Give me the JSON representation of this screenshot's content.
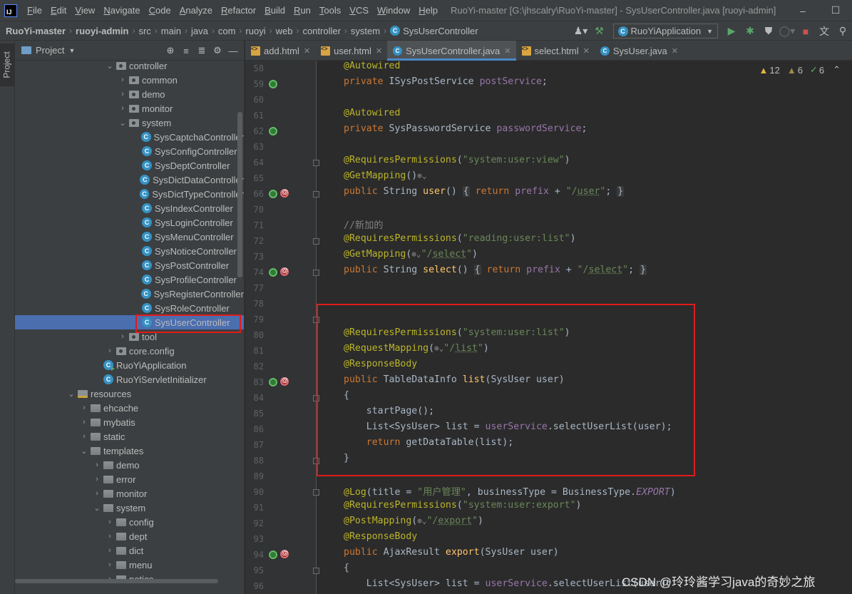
{
  "menubar": {
    "app_logo": "IJ",
    "items": [
      "File",
      "Edit",
      "View",
      "Navigate",
      "Code",
      "Analyze",
      "Refactor",
      "Build",
      "Run",
      "Tools",
      "VCS",
      "Window",
      "Help"
    ],
    "window_title": "RuoYi-master [G:\\jhscalry\\RuoYi-master] - SysUserController.java [ruoyi-admin]",
    "controls": [
      "–",
      "☐"
    ]
  },
  "navbar": {
    "breadcrumbs": [
      "RuoYi-master",
      "ruoyi-admin",
      "src",
      "main",
      "java",
      "com",
      "ruoyi",
      "web",
      "controller",
      "system",
      "SysUserController"
    ],
    "run_config": "RuoYiApplication",
    "toolbar_icons": [
      "user-icon",
      "hammer-icon",
      "run-icon",
      "debug-icon",
      "coverage-icon",
      "profiler-icon",
      "stop-icon",
      "translate-icon",
      "search-everywhere-icon"
    ]
  },
  "left_stripe": {
    "project_label": "Project"
  },
  "project_panel": {
    "title": "Project",
    "header_icons": [
      "locate-icon",
      "expand-all-icon",
      "collapse-all-icon",
      "gear-icon",
      "minimize-icon"
    ],
    "tree": [
      {
        "label": "controller",
        "type": "pkg",
        "arrow": "⌄"
      },
      {
        "label": "common",
        "type": "pkg",
        "arrow": "›"
      },
      {
        "label": "demo",
        "type": "pkg",
        "arrow": "›"
      },
      {
        "label": "monitor",
        "type": "pkg",
        "arrow": "›"
      },
      {
        "label": "system",
        "type": "pkg",
        "arrow": "⌄"
      },
      {
        "label": "SysCaptchaController",
        "type": "cls",
        "arrow": ""
      },
      {
        "label": "SysConfigController",
        "type": "cls",
        "arrow": ""
      },
      {
        "label": "SysDeptController",
        "type": "cls",
        "arrow": ""
      },
      {
        "label": "SysDictDataController",
        "type": "cls",
        "arrow": ""
      },
      {
        "label": "SysDictTypeController",
        "type": "cls",
        "arrow": ""
      },
      {
        "label": "SysIndexController",
        "type": "cls",
        "arrow": ""
      },
      {
        "label": "SysLoginController",
        "type": "cls",
        "arrow": ""
      },
      {
        "label": "SysMenuController",
        "type": "cls",
        "arrow": ""
      },
      {
        "label": "SysNoticeController",
        "type": "cls",
        "arrow": ""
      },
      {
        "label": "SysPostController",
        "type": "cls",
        "arrow": ""
      },
      {
        "label": "SysProfileController",
        "type": "cls",
        "arrow": ""
      },
      {
        "label": "SysRegisterController",
        "type": "cls",
        "arrow": ""
      },
      {
        "label": "SysRoleController",
        "type": "cls",
        "arrow": ""
      },
      {
        "label": "SysUserController",
        "type": "cls",
        "arrow": "",
        "selected": true
      },
      {
        "label": "tool",
        "type": "pkg",
        "arrow": "›"
      },
      {
        "label": "core.config",
        "type": "pkg",
        "arrow": "›"
      },
      {
        "label": "RuoYiApplication",
        "type": "app",
        "arrow": ""
      },
      {
        "label": "RuoYiServletInitializer",
        "type": "cls",
        "arrow": ""
      },
      {
        "label": "resources",
        "type": "res",
        "arrow": "⌄"
      },
      {
        "label": "ehcache",
        "type": "folder",
        "arrow": "›"
      },
      {
        "label": "mybatis",
        "type": "folder",
        "arrow": "›"
      },
      {
        "label": "static",
        "type": "folder",
        "arrow": "›"
      },
      {
        "label": "templates",
        "type": "folder",
        "arrow": "⌄"
      },
      {
        "label": "demo",
        "type": "folder",
        "arrow": "›"
      },
      {
        "label": "error",
        "type": "folder",
        "arrow": "›"
      },
      {
        "label": "monitor",
        "type": "folder",
        "arrow": "›"
      },
      {
        "label": "system",
        "type": "folder",
        "arrow": "⌄"
      },
      {
        "label": "config",
        "type": "folder",
        "arrow": "›"
      },
      {
        "label": "dept",
        "type": "folder",
        "arrow": "›"
      },
      {
        "label": "dict",
        "type": "folder",
        "arrow": "›"
      },
      {
        "label": "menu",
        "type": "folder",
        "arrow": "›"
      },
      {
        "label": "notice",
        "type": "folder",
        "arrow": "›"
      }
    ]
  },
  "editor_tabs": [
    {
      "label": "add.html",
      "kind": "html",
      "active": false
    },
    {
      "label": "user.html",
      "kind": "html",
      "active": false
    },
    {
      "label": "SysUserController.java",
      "kind": "java",
      "active": true
    },
    {
      "label": "select.html",
      "kind": "html",
      "active": false
    },
    {
      "label": "SysUser.java",
      "kind": "java",
      "active": false
    }
  ],
  "inspections": {
    "warnings": "12",
    "weak_warnings": "6",
    "ok": "6"
  },
  "editor": {
    "lines": [
      {
        "n": "58",
        "html": "<span class=\"ann\">@Autowired</span>"
      },
      {
        "n": "59",
        "html": "<span class=\"kw\">private</span> ISysPostService <span class=\"fld\">postService</span>;",
        "icon": "bean"
      },
      {
        "n": "60",
        "html": ""
      },
      {
        "n": "61",
        "html": "<span class=\"ann\">@Autowired</span>"
      },
      {
        "n": "62",
        "html": "<span class=\"kw\">private</span> SysPasswordService <span class=\"fld\">passwordService</span>;",
        "icon": "bean"
      },
      {
        "n": "63",
        "html": ""
      },
      {
        "n": "64",
        "html": "<span class=\"ann\">@RequiresPermissions</span>(<span class=\"str\">\"system:user:view\"</span>)",
        "fold": true
      },
      {
        "n": "65",
        "html": "<span class=\"ann\">@GetMapping</span>()<span class=\"web-ico\">⊕⌄</span>"
      },
      {
        "n": "66",
        "html": "<span class=\"kw\">public</span> String <span class=\"mth\">user</span>() <span class=\"fold-box\">{</span> <span class=\"kw\">return</span> <span class=\"fld\">prefix</span> + <span class=\"str\">\"/<span class=\"usc\">user</span>\"</span>; <span class=\"fold-box\">}</span>",
        "icon": "bean-map",
        "fold": true
      },
      {
        "n": "70",
        "html": ""
      },
      {
        "n": "71",
        "html": "<span class=\"cmt\">//新加的</span>"
      },
      {
        "n": "72",
        "html": "<span class=\"ann\">@RequiresPermissions</span>(<span class=\"str\">\"reading:user:list\"</span>)",
        "fold": true
      },
      {
        "n": "73",
        "html": "<span class=\"ann\">@GetMapping</span>(<span class=\"web-ico\">⊕⌄</span><span class=\"str\">\"/<span class=\"usc\">select</span>\"</span>)"
      },
      {
        "n": "74",
        "html": "<span class=\"kw\">public</span> String <span class=\"mth\">select</span>() <span class=\"fold-box\">{</span> <span class=\"kw\">return</span> <span class=\"fld\">prefix</span> + <span class=\"str\">\"/<span class=\"usc\">select</span>\"</span>; <span class=\"fold-box\">}</span>",
        "icon": "bean-map",
        "fold": true
      },
      {
        "n": "77",
        "html": ""
      },
      {
        "n": "78",
        "html": ""
      },
      {
        "n": "79",
        "html": "",
        "fold": true
      },
      {
        "n": "80",
        "html": "<span class=\"ann\">@RequiresPermissions</span>(<span class=\"str\">\"system:user:list\"</span>)"
      },
      {
        "n": "81",
        "html": "<span class=\"ann\">@RequestMapping</span>(<span class=\"web-ico\">⊕⌄</span><span class=\"str\">\"/<span class=\"usc\">list</span>\"</span>)"
      },
      {
        "n": "82",
        "html": "<span class=\"ann\">@ResponseBody</span>"
      },
      {
        "n": "83",
        "html": "<span class=\"kw\">public</span> TableDataInfo <span class=\"mth\">list</span>(SysUser user)",
        "icon": "bean-map"
      },
      {
        "n": "84",
        "html": "{",
        "fold": true
      },
      {
        "n": "85",
        "html": "    startPage();"
      },
      {
        "n": "86",
        "html": "    List&lt;SysUser&gt; list = <span class=\"fld\">userService</span>.selectUserList(user);"
      },
      {
        "n": "87",
        "html": "    <span class=\"kw\">return</span> getDataTable(list);"
      },
      {
        "n": "88",
        "html": "}",
        "fold": true
      },
      {
        "n": "89",
        "html": ""
      },
      {
        "n": "90",
        "html": "<span class=\"ann\">@Log</span>(title = <span class=\"str\">\"用户管理\"</span>, businessType = BusinessType.<span class=\"exp\">EXPORT</span>)",
        "fold": true
      },
      {
        "n": "91",
        "html": "<span class=\"ann\">@RequiresPermissions</span>(<span class=\"str\">\"system:user:export\"</span>)"
      },
      {
        "n": "92",
        "html": "<span class=\"ann\">@PostMapping</span>(<span class=\"web-ico\">⊕⌄</span><span class=\"str\">\"/<span class=\"usc\">export</span>\"</span>)"
      },
      {
        "n": "93",
        "html": "<span class=\"ann\">@ResponseBody</span>"
      },
      {
        "n": "94",
        "html": "<span class=\"kw\">public</span> AjaxResult <span class=\"mth\">export</span>(SysUser user)",
        "icon": "bean-map"
      },
      {
        "n": "95",
        "html": "{",
        "fold": true
      },
      {
        "n": "96",
        "html": "    List&lt;SysUser&gt; list = <span class=\"fld\">userService</span>.selectUserList(user);"
      }
    ]
  },
  "watermark": "CSDN @玲玲酱学习java的奇妙之旅"
}
